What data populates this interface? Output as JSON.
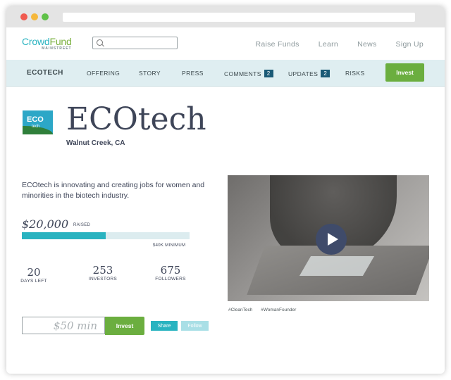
{
  "nav": {
    "logo_main_crowd": "Crowd",
    "logo_main_fund": "Fund",
    "logo_sub": "MAINSTREET",
    "search_placeholder": "",
    "links": [
      "Raise Funds",
      "Learn",
      "News",
      "Sign Up"
    ]
  },
  "subnav": {
    "brand": "ECOTECH",
    "items": [
      "OFFERING",
      "STORY",
      "PRESS",
      "COMMENTS",
      "UPDATES",
      "RISKS"
    ],
    "comments_count": "2",
    "updates_count": "2",
    "invest_label": "Invest"
  },
  "company": {
    "logo_text_top": "ECO",
    "logo_text_bottom": "tech",
    "name": "ECOtech",
    "location": "Walnut Creek, CA",
    "description": "ECOtech is innovating and creating jobs for women and minorities in the biotech industry."
  },
  "funding": {
    "raised": "$20,000",
    "raised_label": "RAISED",
    "progress_fraction": 0.5,
    "minimum": "$40K MINIMUM",
    "stats": [
      {
        "num": "20",
        "label": "DAYS LEFT"
      },
      {
        "num": "253",
        "label": "INVESTORS"
      },
      {
        "num": "675",
        "label": "FOLLOWERS"
      }
    ]
  },
  "actions": {
    "amount_placeholder": "$50 min",
    "invest_label": "Invest",
    "share_label": "Share",
    "follow_label": "Follow"
  },
  "video": {
    "tags": [
      "#CleanTech",
      "#WomanFounder"
    ]
  },
  "colors": {
    "accent_teal": "#29b3c0",
    "accent_green": "#6bae3f",
    "badge_navy": "#1a5a76",
    "title_color": "#3e4558"
  }
}
